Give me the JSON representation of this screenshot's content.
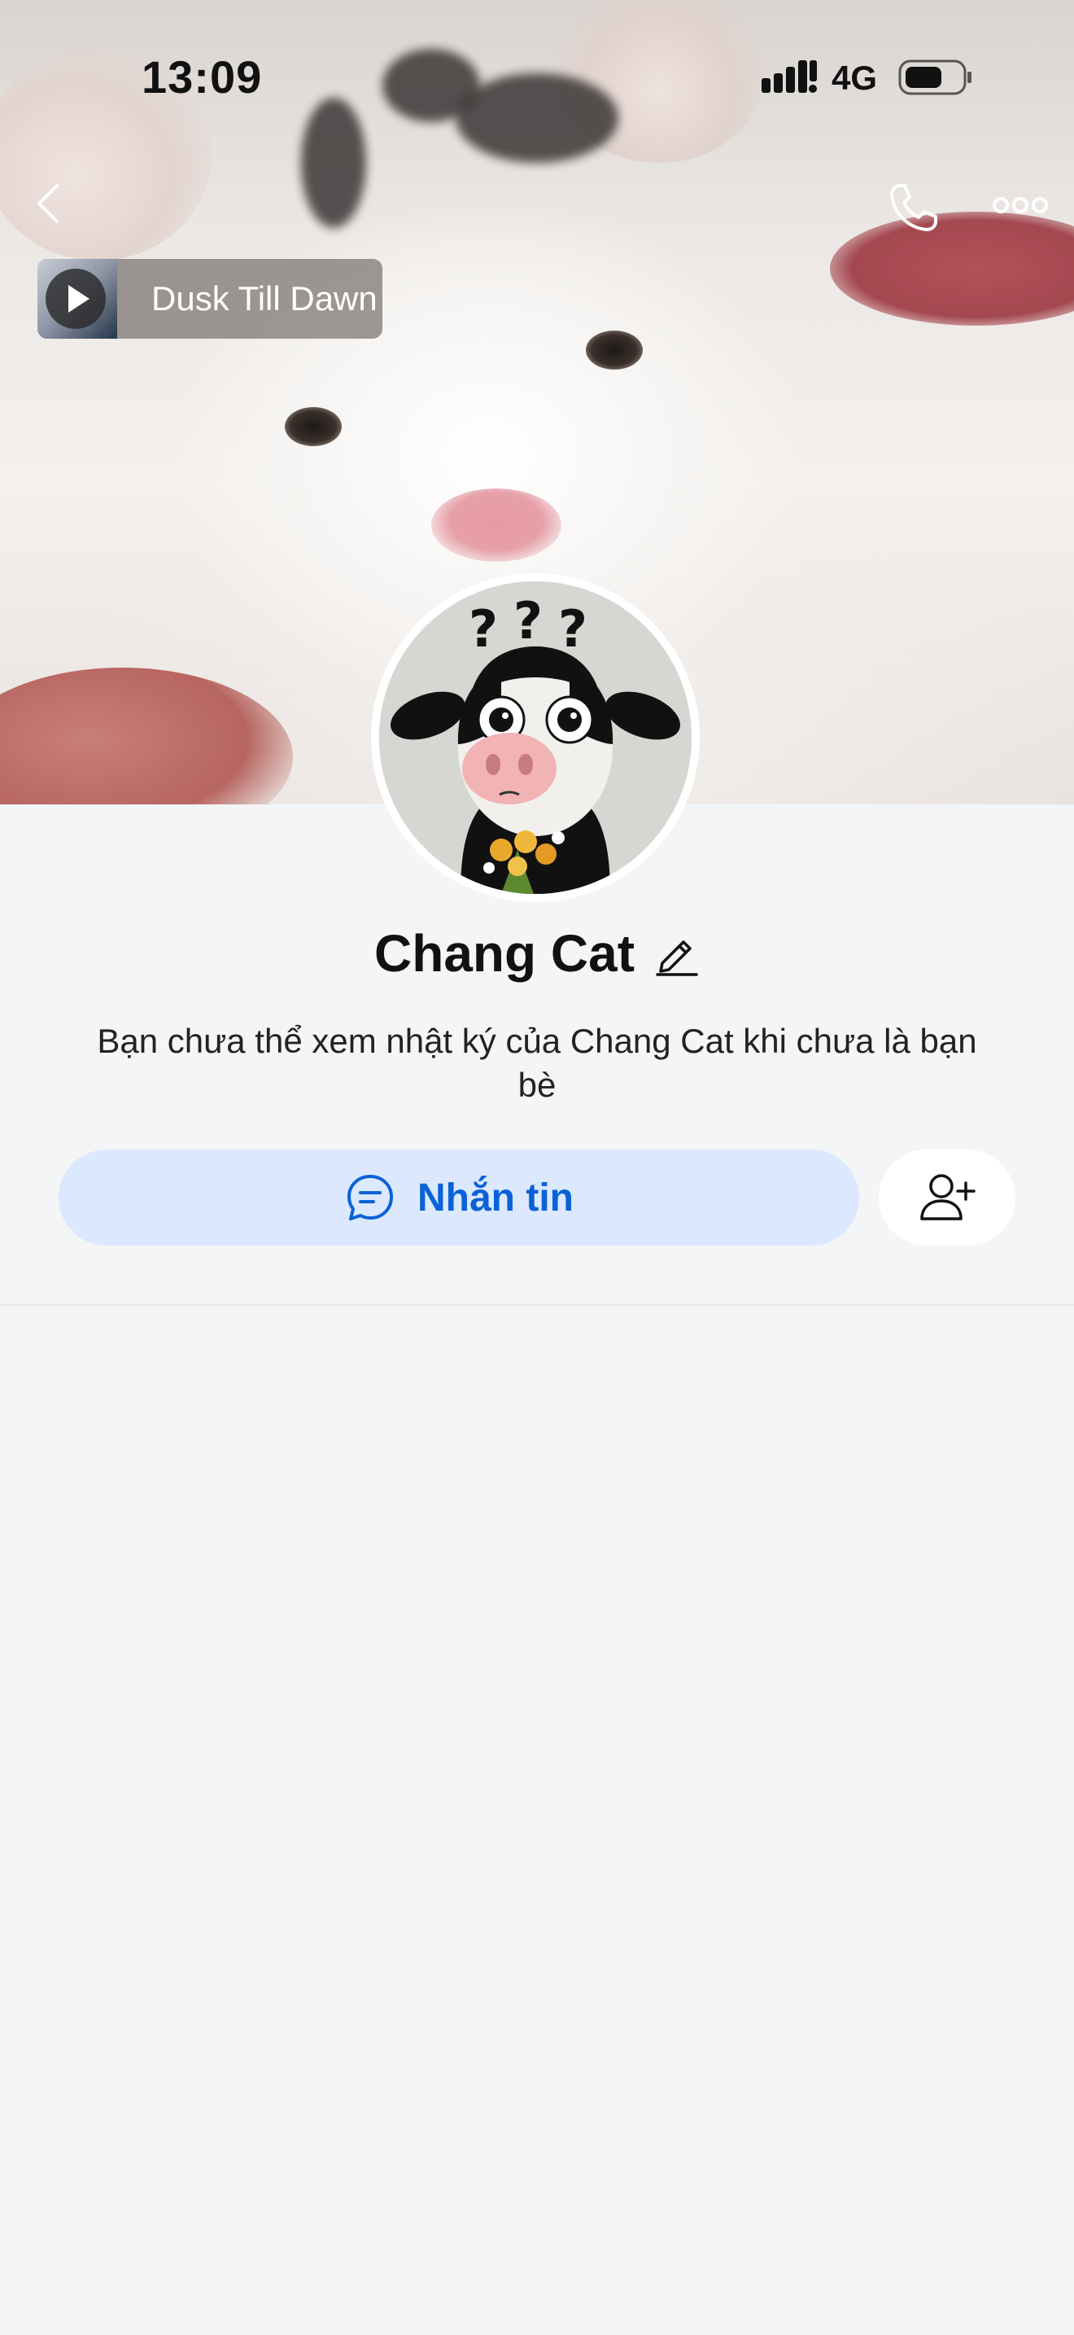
{
  "status_bar": {
    "time": "13:09",
    "network": "4G"
  },
  "music": {
    "title": "Dusk Till Dawn"
  },
  "profile": {
    "name": "Chang Cat",
    "description": "Bạn chưa thể xem nhật ký của Chang Cat khi chưa là bạn bè"
  },
  "actions": {
    "message_label": "Nhắn tin"
  },
  "icons": {
    "back": "chevron-left-icon",
    "call": "phone-icon",
    "more": "more-dots-icon",
    "play": "play-icon",
    "edit": "pencil-icon",
    "message": "chat-bubble-icon",
    "add_friend": "add-user-icon"
  },
  "colors": {
    "accent": "#0b62d6",
    "button_bg": "#dbe8fd",
    "background": "#f4f5f7"
  }
}
